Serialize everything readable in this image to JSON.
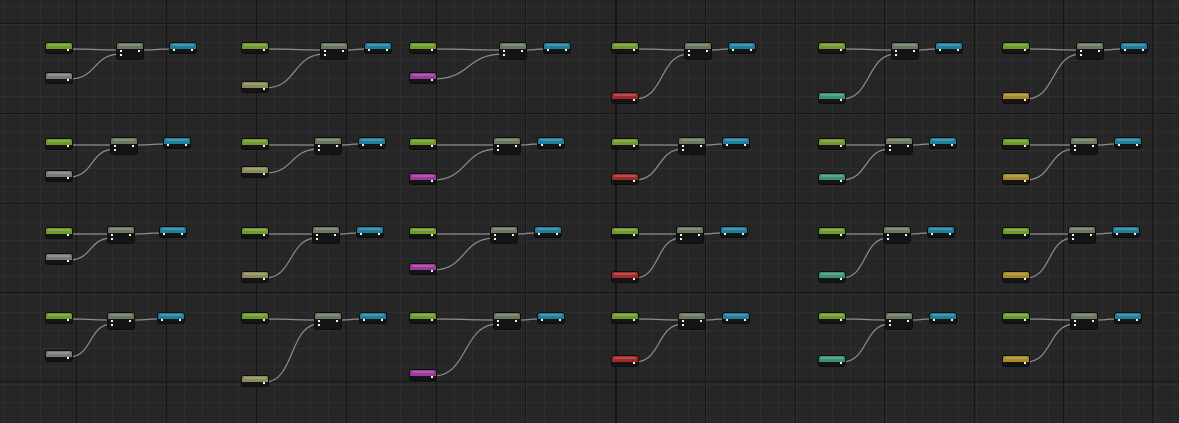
{
  "editor": {
    "kind": "material-node-graph",
    "colors": {
      "background": "#262626",
      "grid_major": "#161616",
      "grid_minor": "#2e2e2e",
      "wire": "#8e8e8e",
      "node_body": "#141414",
      "top_input": "#6e9a2a",
      "multiply": "#69785e",
      "output": "#1f7f9a",
      "column_inputs": [
        "#7a7a7a",
        "#8a8a58",
        "#9a3a9a",
        "#a02a2a",
        "#3e8f78",
        "#a88a2a"
      ]
    },
    "node_types": {
      "top_input": "constant-input-node",
      "bottom_input": "secondary-input-node",
      "combine": "multiply-node",
      "output": "result-node"
    },
    "rows": 4,
    "columns": 6
  }
}
